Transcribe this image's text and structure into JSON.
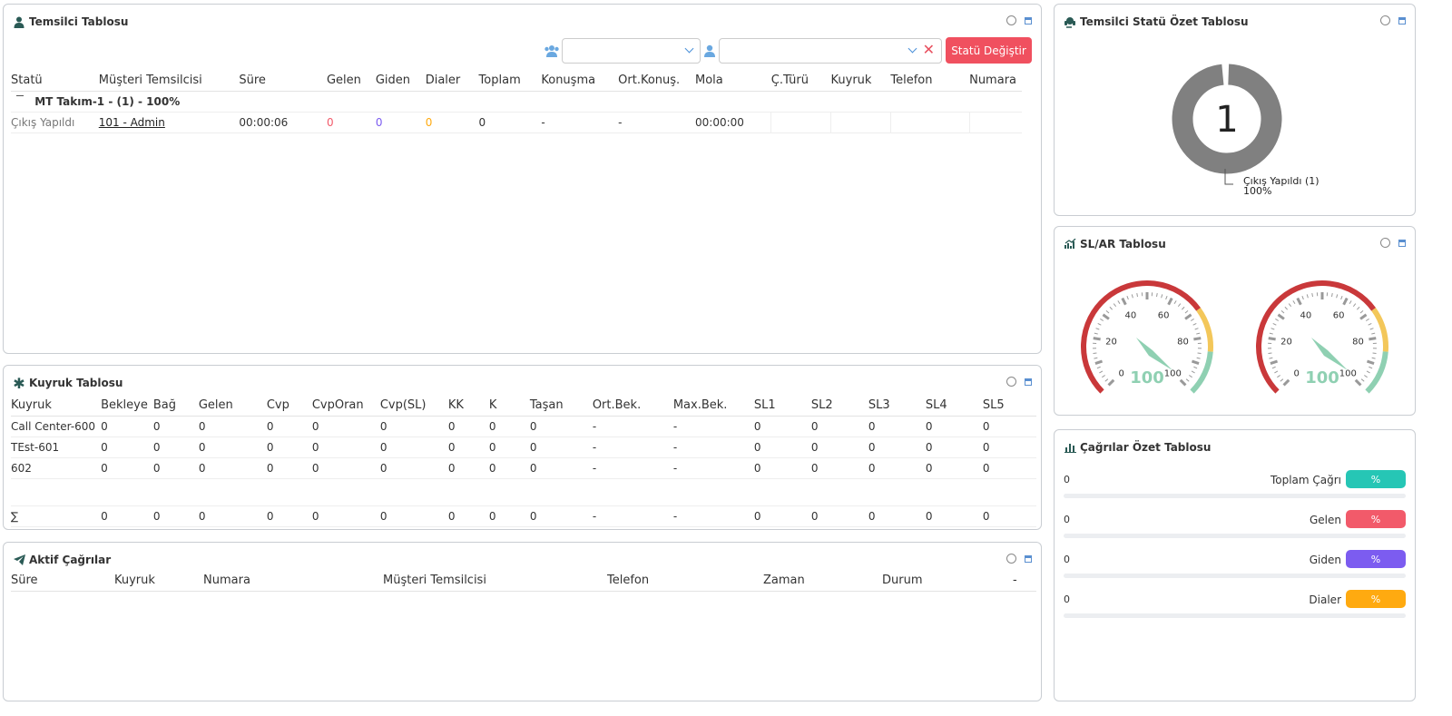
{
  "agent_panel": {
    "title": "Temsilci Tablosu",
    "status_button": "Statü Değiştir",
    "columns": [
      "Statü",
      "Müşteri Temsilcisi",
      "Süre",
      "Gelen",
      "Giden",
      "Dialer",
      "Toplam",
      "Konuşma",
      "Ort.Konuş.",
      "Mola",
      "Ç.Türü",
      "Kuyruk",
      "Telefon",
      "Numara"
    ],
    "group_label": "MT Takım-1 - (1) - 100%",
    "row": {
      "status": "Çıkış Yapıldı",
      "agent": "101 - Admin",
      "duration": "00:00:06",
      "incoming": "0",
      "outgoing": "0",
      "dialer": "0",
      "total": "0",
      "talk": "-",
      "avg_talk": "-",
      "break": "00:00:00"
    }
  },
  "queue_panel": {
    "title": "Kuyruk Tablosu",
    "columns": [
      "Kuyruk",
      "Bekleye",
      "Bağ",
      "Gelen",
      "Cvp",
      "CvpOran",
      "Cvp(SL)",
      "KK",
      "K",
      "Taşan",
      "Ort.Bek.",
      "Max.Bek.",
      "SL1",
      "SL2",
      "SL3",
      "SL4",
      "SL5"
    ],
    "rows": [
      [
        "Call Center-600",
        "0",
        "0",
        "0",
        "0",
        "0",
        "0",
        "0",
        "0",
        "0",
        "-",
        "-",
        "0",
        "0",
        "0",
        "0",
        "0"
      ],
      [
        "TEst-601",
        "0",
        "0",
        "0",
        "0",
        "0",
        "0",
        "0",
        "0",
        "0",
        "-",
        "-",
        "0",
        "0",
        "0",
        "0",
        "0"
      ],
      [
        "602",
        "0",
        "0",
        "0",
        "0",
        "0",
        "0",
        "0",
        "0",
        "0",
        "-",
        "-",
        "0",
        "0",
        "0",
        "0",
        "0"
      ]
    ],
    "total_row": [
      "∑",
      "0",
      "0",
      "0",
      "0",
      "0",
      "0",
      "0",
      "0",
      "0",
      "-",
      "-",
      "0",
      "0",
      "0",
      "0",
      "0"
    ]
  },
  "active_calls_panel": {
    "title": "Aktif Çağrılar",
    "columns": [
      "Süre",
      "Kuyruk",
      "Numara",
      "Müşteri Temsilcisi",
      "Telefon",
      "Zaman",
      "Durum",
      "-"
    ]
  },
  "status_summary_panel": {
    "title": "Temsilci Statü Özet Tablosu",
    "center_value": "1",
    "legend_label": "Çıkış Yapıldı (1)",
    "legend_percent": "100%",
    "ring_color": "#808080"
  },
  "slar_panel": {
    "title": "SL/AR Tablosu",
    "gauges": [
      {
        "value": 100,
        "ticks": [
          "0",
          "20",
          "40",
          "60",
          "80",
          "100"
        ]
      },
      {
        "value": 100,
        "ticks": [
          "0",
          "20",
          "40",
          "60",
          "80",
          "100"
        ]
      }
    ]
  },
  "calls_summary_panel": {
    "title": "Çağrılar Özet Tablosu",
    "rows": [
      {
        "value": "0",
        "label": "Toplam Çağrı",
        "pill": "%",
        "color": "#26c6b5"
      },
      {
        "value": "0",
        "label": "Gelen",
        "pill": "%",
        "color": "#f25a6a"
      },
      {
        "value": "0",
        "label": "Giden",
        "pill": "%",
        "color": "#7c5cf0"
      },
      {
        "value": "0",
        "label": "Dialer",
        "pill": "%",
        "color": "#ffaa10"
      }
    ]
  }
}
